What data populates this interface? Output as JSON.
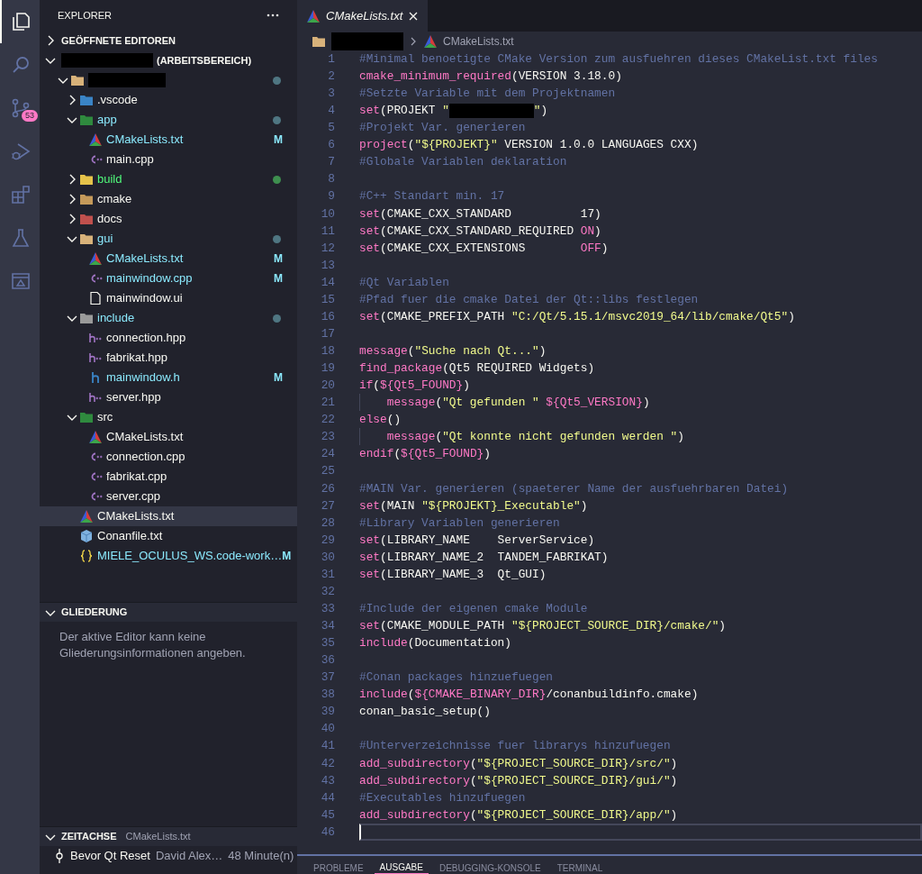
{
  "activity_bar": [
    {
      "kind": "files",
      "selected": true
    },
    {
      "kind": "search",
      "selected": false
    },
    {
      "kind": "scm",
      "selected": false,
      "badge": "53"
    },
    {
      "kind": "debug",
      "selected": false
    },
    {
      "kind": "extensions",
      "selected": false
    },
    {
      "kind": "testing",
      "selected": false
    },
    {
      "kind": "remote",
      "selected": false
    }
  ],
  "sidebar": {
    "title": "EXPLORER",
    "open_editors": {
      "label": "GEÖFFNETE EDITOREN",
      "expanded": false
    },
    "workspace": {
      "label": "(ARBEITSBEREICH)",
      "expanded": true,
      "redacted": true
    },
    "tree": [
      {
        "kind": "rootfolder",
        "redacted": true,
        "expanded": true,
        "selected": false,
        "color": "#4f7682",
        "children": [
          {
            "kind": "vscodefolder",
            "label": ".vscode",
            "expanded": false,
            "selected": false,
            "modified": false,
            "untracked": false
          },
          {
            "kind": "appfolder",
            "label": "app",
            "expanded": true,
            "selected": false,
            "modified": true,
            "untracked": false,
            "color": "#4f7682",
            "children": [
              {
                "kind": "cmake",
                "label": "CMakeLists.txt",
                "selected": false,
                "modified": true,
                "untracked": false,
                "badge": "M"
              },
              {
                "kind": "cpp",
                "label": "main.cpp",
                "selected": false,
                "modified": false,
                "untracked": false
              }
            ]
          },
          {
            "kind": "buildfolder",
            "label": "build",
            "expanded": false,
            "selected": false,
            "modified": false,
            "untracked": true,
            "color": "#3e8f4f"
          },
          {
            "kind": "cmakefolder",
            "label": "cmake",
            "expanded": false,
            "selected": false,
            "modified": false,
            "untracked": false
          },
          {
            "kind": "docsfolder",
            "label": "docs",
            "expanded": false,
            "selected": false,
            "modified": false,
            "untracked": false
          },
          {
            "kind": "guifolder",
            "label": "gui",
            "expanded": true,
            "selected": false,
            "modified": true,
            "untracked": false,
            "color": "#4f7682",
            "children": [
              {
                "kind": "cmake",
                "label": "CMakeLists.txt",
                "selected": false,
                "modified": true,
                "untracked": false,
                "badge": "M"
              },
              {
                "kind": "cpp",
                "label": "mainwindow.cpp",
                "selected": false,
                "modified": true,
                "untracked": false,
                "badge": "M"
              },
              {
                "kind": "ui",
                "label": "mainwindow.ui",
                "selected": false,
                "modified": false,
                "untracked": false
              }
            ]
          },
          {
            "kind": "includefolder",
            "label": "include",
            "expanded": true,
            "selected": false,
            "modified": true,
            "untracked": false,
            "color": "#4f7682",
            "children": [
              {
                "kind": "hpp",
                "label": "connection.hpp",
                "selected": false,
                "modified": false,
                "untracked": false
              },
              {
                "kind": "hpp",
                "label": "fabrikat.hpp",
                "selected": false,
                "modified": false,
                "untracked": false
              },
              {
                "kind": "header",
                "label": "mainwindow.h",
                "selected": false,
                "modified": true,
                "untracked": false,
                "badge": "M"
              },
              {
                "kind": "hpp",
                "label": "server.hpp",
                "selected": false,
                "modified": false,
                "untracked": false
              }
            ]
          },
          {
            "kind": "srcfolder",
            "label": "src",
            "expanded": true,
            "selected": false,
            "modified": false,
            "untracked": false,
            "children": [
              {
                "kind": "cmake",
                "label": "CMakeLists.txt",
                "selected": false,
                "modified": false,
                "untracked": false
              },
              {
                "kind": "cpp",
                "label": "connection.cpp",
                "selected": false,
                "modified": false,
                "untracked": false
              },
              {
                "kind": "cpp",
                "label": "fabrikat.cpp",
                "selected": false,
                "modified": false,
                "untracked": false
              },
              {
                "kind": "cpp",
                "label": "server.cpp",
                "selected": false,
                "modified": false,
                "untracked": false
              }
            ]
          },
          {
            "kind": "cmake",
            "label": "CMakeLists.txt",
            "selected": true,
            "modified": false,
            "untracked": false
          },
          {
            "kind": "conan",
            "label": "Conanfile.txt",
            "selected": false,
            "modified": false,
            "untracked": false
          },
          {
            "kind": "json",
            "label": "MIELE_OCULUS_WS.code-work…",
            "selected": false,
            "modified": true,
            "untracked": false,
            "badge": "M"
          }
        ]
      }
    ],
    "outline": {
      "label": "GLIEDERUNG",
      "expanded": true,
      "message": "Der aktive Editor kann keine Gliederungsinformationen angeben."
    },
    "timeline": {
      "label": "ZEITACHSE",
      "file": "CMakeLists.txt",
      "expanded": true,
      "entries": [
        {
          "title": "Bevor Qt Reset",
          "author": "David Alex…",
          "time": "48 Minute(n)"
        }
      ]
    }
  },
  "editor": {
    "tabs": [
      {
        "label": "CMakeLists.txt",
        "kind": "cmake",
        "selected": true,
        "preview": true
      }
    ],
    "breadcrumb": [
      {
        "kind": "redacted"
      },
      {
        "kind": "cmake",
        "label": "CMakeLists.txt"
      }
    ],
    "lines": [
      {
        "n": "1",
        "current": false,
        "tokens": [
          {
            "kind": "comment",
            "text": "#Minimal benoetigte CMake Version zum ausfuehren dieses CMakeList.txt files"
          }
        ]
      },
      {
        "n": "2",
        "current": false,
        "tokens": [
          {
            "kind": "function",
            "text": "cmake_minimum_required"
          },
          {
            "kind": "plain",
            "text": "(VERSION 3.18.0)"
          }
        ]
      },
      {
        "n": "3",
        "current": false,
        "tokens": [
          {
            "kind": "comment",
            "text": "#Setzte Variable mit dem Projektnamen"
          }
        ]
      },
      {
        "n": "4",
        "current": false,
        "tokens": [
          {
            "kind": "function",
            "text": "set"
          },
          {
            "kind": "plain",
            "text": "(PROJEKT "
          },
          {
            "kind": "string",
            "text": "\""
          },
          {
            "kind": "redacted"
          },
          {
            "kind": "string",
            "text": "\""
          },
          {
            "kind": "plain",
            "text": ")"
          }
        ]
      },
      {
        "n": "5",
        "current": false,
        "tokens": [
          {
            "kind": "comment",
            "text": "#Projekt Var. generieren"
          }
        ]
      },
      {
        "n": "6",
        "current": false,
        "tokens": [
          {
            "kind": "function",
            "text": "project"
          },
          {
            "kind": "plain",
            "text": "("
          },
          {
            "kind": "string",
            "text": "\"${PROJEKT}\""
          },
          {
            "kind": "plain",
            "text": " VERSION 1.0.0 LANGUAGES CXX)"
          }
        ]
      },
      {
        "n": "7",
        "current": false,
        "tokens": [
          {
            "kind": "comment",
            "text": "#Globale Variablen deklaration"
          }
        ]
      },
      {
        "n": "8",
        "current": false
      },
      {
        "n": "9",
        "current": false,
        "tokens": [
          {
            "kind": "comment",
            "text": "#C++ Standart min. 17"
          }
        ]
      },
      {
        "n": "10",
        "current": false,
        "tokens": [
          {
            "kind": "function",
            "text": "set"
          },
          {
            "kind": "plain",
            "text": "(CMAKE_CXX_STANDARD          17)"
          }
        ]
      },
      {
        "n": "11",
        "current": false,
        "tokens": [
          {
            "kind": "function",
            "text": "set"
          },
          {
            "kind": "plain",
            "text": "(CMAKE_CXX_STANDARD_REQUIRED "
          },
          {
            "kind": "keyword",
            "text": "ON"
          },
          {
            "kind": "plain",
            "text": ")"
          }
        ]
      },
      {
        "n": "12",
        "current": false,
        "tokens": [
          {
            "kind": "function",
            "text": "set"
          },
          {
            "kind": "plain",
            "text": "(CMAKE_CXX_EXTENSIONS        "
          },
          {
            "kind": "keyword",
            "text": "OFF"
          },
          {
            "kind": "plain",
            "text": ")"
          }
        ]
      },
      {
        "n": "13",
        "current": false
      },
      {
        "n": "14",
        "current": false,
        "tokens": [
          {
            "kind": "comment",
            "text": "#Qt Variablen"
          }
        ]
      },
      {
        "n": "15",
        "current": false,
        "tokens": [
          {
            "kind": "comment",
            "text": "#Pfad fuer die cmake Datei der Qt::libs festlegen"
          }
        ]
      },
      {
        "n": "16",
        "current": false,
        "tokens": [
          {
            "kind": "function",
            "text": "set"
          },
          {
            "kind": "plain",
            "text": "(CMAKE_PREFIX_PATH "
          },
          {
            "kind": "string",
            "text": "\"C:/Qt/5.15.1/msvc2019_64/lib/cmake/Qt5\""
          },
          {
            "kind": "plain",
            "text": ")"
          }
        ]
      },
      {
        "n": "17",
        "current": false
      },
      {
        "n": "18",
        "current": false,
        "tokens": [
          {
            "kind": "function",
            "text": "message"
          },
          {
            "kind": "plain",
            "text": "("
          },
          {
            "kind": "string",
            "text": "\"Suche nach Qt...\""
          },
          {
            "kind": "plain",
            "text": ")"
          }
        ]
      },
      {
        "n": "19",
        "current": false,
        "tokens": [
          {
            "kind": "function",
            "text": "find_package"
          },
          {
            "kind": "plain",
            "text": "(Qt5 REQUIRED Widgets)"
          }
        ]
      },
      {
        "n": "20",
        "current": false,
        "tokens": [
          {
            "kind": "function",
            "text": "if"
          },
          {
            "kind": "plain",
            "text": "("
          },
          {
            "kind": "variable",
            "text": "${Qt5_FOUND}"
          },
          {
            "kind": "plain",
            "text": ")"
          }
        ]
      },
      {
        "n": "21",
        "current": false,
        "tokens": [
          {
            "kind": "indent"
          },
          {
            "kind": "function",
            "text": "message"
          },
          {
            "kind": "plain",
            "text": "("
          },
          {
            "kind": "string",
            "text": "\"Qt gefunden \""
          },
          {
            "kind": "variable",
            "text": " ${Qt5_VERSION}"
          },
          {
            "kind": "plain",
            "text": ")"
          }
        ]
      },
      {
        "n": "22",
        "current": false,
        "tokens": [
          {
            "kind": "function",
            "text": "else"
          },
          {
            "kind": "plain",
            "text": "()"
          }
        ]
      },
      {
        "n": "23",
        "current": false,
        "tokens": [
          {
            "kind": "indent"
          },
          {
            "kind": "function",
            "text": "message"
          },
          {
            "kind": "plain",
            "text": "("
          },
          {
            "kind": "string",
            "text": "\"Qt konnte nicht gefunden werden \""
          },
          {
            "kind": "plain",
            "text": ")"
          }
        ]
      },
      {
        "n": "24",
        "current": false,
        "tokens": [
          {
            "kind": "function",
            "text": "endif"
          },
          {
            "kind": "plain",
            "text": "("
          },
          {
            "kind": "variable",
            "text": "${Qt5_FOUND}"
          },
          {
            "kind": "plain",
            "text": ")"
          }
        ]
      },
      {
        "n": "25",
        "current": false
      },
      {
        "n": "26",
        "current": false,
        "tokens": [
          {
            "kind": "comment",
            "text": "#MAIN Var. generieren (spaeterer Name der ausfuehrbaren Datei)"
          }
        ]
      },
      {
        "n": "27",
        "current": false,
        "tokens": [
          {
            "kind": "function",
            "text": "set"
          },
          {
            "kind": "plain",
            "text": "(MAIN "
          },
          {
            "kind": "string",
            "text": "\"${PROJEKT}_Executable\""
          },
          {
            "kind": "plain",
            "text": ")"
          }
        ]
      },
      {
        "n": "28",
        "current": false,
        "tokens": [
          {
            "kind": "comment",
            "text": "#Library Variablen generieren"
          }
        ]
      },
      {
        "n": "29",
        "current": false,
        "tokens": [
          {
            "kind": "function",
            "text": "set"
          },
          {
            "kind": "plain",
            "text": "(LIBRARY_NAME    ServerService)"
          }
        ]
      },
      {
        "n": "30",
        "current": false,
        "tokens": [
          {
            "kind": "function",
            "text": "set"
          },
          {
            "kind": "plain",
            "text": "(LIBRARY_NAME_2  TANDEM_FABRIKAT)"
          }
        ]
      },
      {
        "n": "31",
        "current": false,
        "tokens": [
          {
            "kind": "function",
            "text": "set"
          },
          {
            "kind": "plain",
            "text": "(LIBRARY_NAME_3  Qt_GUI)"
          }
        ]
      },
      {
        "n": "32",
        "current": false
      },
      {
        "n": "33",
        "current": false,
        "tokens": [
          {
            "kind": "comment",
            "text": "#Include der eigenen cmake Module"
          }
        ]
      },
      {
        "n": "34",
        "current": false,
        "tokens": [
          {
            "kind": "function",
            "text": "set"
          },
          {
            "kind": "plain",
            "text": "(CMAKE_MODULE_PATH "
          },
          {
            "kind": "string",
            "text": "\"${PROJECT_SOURCE_DIR}/cmake/\""
          },
          {
            "kind": "plain",
            "text": ")"
          }
        ]
      },
      {
        "n": "35",
        "current": false,
        "tokens": [
          {
            "kind": "function",
            "text": "include"
          },
          {
            "kind": "plain",
            "text": "(Documentation)"
          }
        ]
      },
      {
        "n": "36",
        "current": false
      },
      {
        "n": "37",
        "current": false,
        "tokens": [
          {
            "kind": "comment",
            "text": "#Conan packages hinzuefuegen"
          }
        ]
      },
      {
        "n": "38",
        "current": false,
        "tokens": [
          {
            "kind": "function",
            "text": "include"
          },
          {
            "kind": "plain",
            "text": "("
          },
          {
            "kind": "variable",
            "text": "${CMAKE_BINARY_DIR}"
          },
          {
            "kind": "plain",
            "text": "/conanbuildinfo.cmake)"
          }
        ]
      },
      {
        "n": "39",
        "current": false,
        "tokens": [
          {
            "kind": "plain",
            "text": "conan_basic_setup()"
          }
        ]
      },
      {
        "n": "40",
        "current": false
      },
      {
        "n": "41",
        "current": false,
        "tokens": [
          {
            "kind": "comment",
            "text": "#Unterverzeichnisse fuer librarys hinzufuegen"
          }
        ]
      },
      {
        "n": "42",
        "current": false,
        "tokens": [
          {
            "kind": "function",
            "text": "add_subdirectory"
          },
          {
            "kind": "plain",
            "text": "("
          },
          {
            "kind": "string",
            "text": "\"${PROJECT_SOURCE_DIR}/src/\""
          },
          {
            "kind": "plain",
            "text": ")"
          }
        ]
      },
      {
        "n": "43",
        "current": false,
        "tokens": [
          {
            "kind": "function",
            "text": "add_subdirectory"
          },
          {
            "kind": "plain",
            "text": "("
          },
          {
            "kind": "string",
            "text": "\"${PROJECT_SOURCE_DIR}/gui/\""
          },
          {
            "kind": "plain",
            "text": ")"
          }
        ]
      },
      {
        "n": "44",
        "current": false,
        "tokens": [
          {
            "kind": "comment",
            "text": "#Executables hinzufuegen"
          }
        ]
      },
      {
        "n": "45",
        "current": false,
        "tokens": [
          {
            "kind": "function",
            "text": "add_subdirectory"
          },
          {
            "kind": "plain",
            "text": "("
          },
          {
            "kind": "string",
            "text": "\"${PROJECT_SOURCE_DIR}/app/\""
          },
          {
            "kind": "plain",
            "text": ")"
          }
        ]
      },
      {
        "n": "46",
        "current": true
      }
    ]
  },
  "panel": {
    "tabs": [
      {
        "label": "PROBLEME",
        "selected": false
      },
      {
        "label": "AUSGABE",
        "selected": true
      },
      {
        "label": "DEBUGGING-KONSOLE",
        "selected": false
      },
      {
        "label": "TERMINAL",
        "selected": false
      }
    ]
  }
}
